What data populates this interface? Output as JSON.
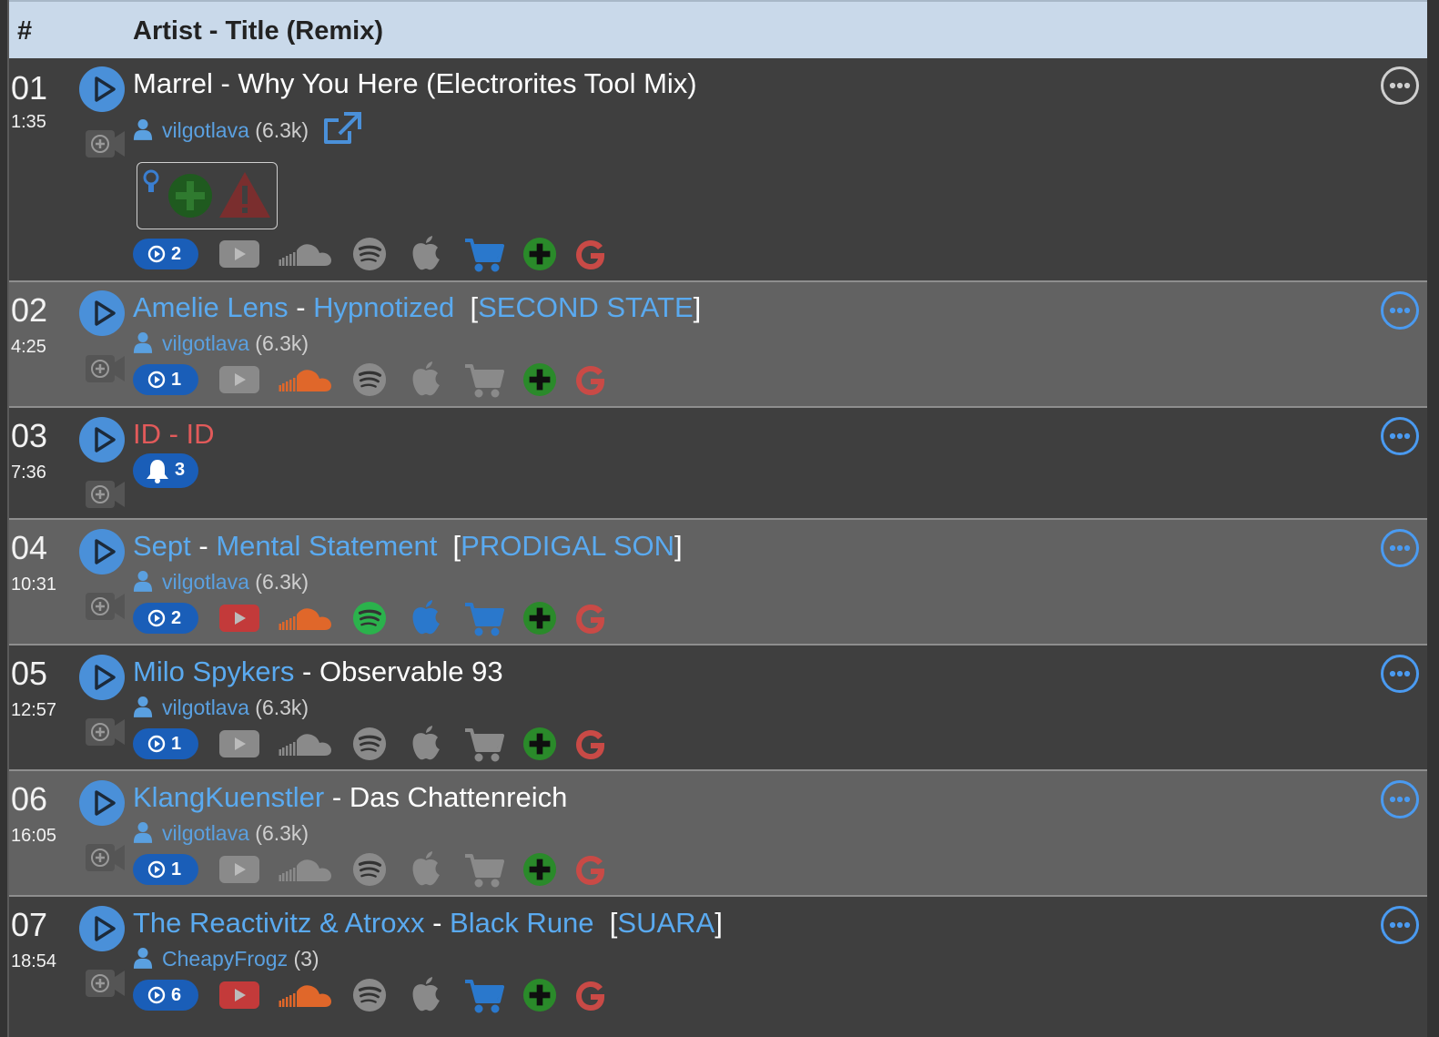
{
  "header": {
    "num": "#",
    "title": "Artist - Title (Remix)"
  },
  "tracks": [
    {
      "num": "01",
      "time": "1:35",
      "title_plain": "Marrel - Why You Here (Electrorites Tool Mix)",
      "user": "vilgotlava",
      "user_count": "(6.3k)",
      "plays": "2"
    },
    {
      "num": "02",
      "time": "4:25",
      "artist": "Amelie Lens",
      "sep": " - ",
      "song": "Hypnotized",
      "label_open": "[",
      "label": "SECOND STATE",
      "label_close": "]",
      "user": "vilgotlava",
      "user_count": "(6.3k)",
      "plays": "1"
    },
    {
      "num": "03",
      "time": "7:36",
      "title_id": "ID - ID",
      "bell": "3"
    },
    {
      "num": "04",
      "time": "10:31",
      "artist": "Sept",
      "sep": " - ",
      "song": "Mental Statement",
      "label_open": "[",
      "label": "PRODIGAL SON",
      "label_close": "]",
      "user": "vilgotlava",
      "user_count": "(6.3k)",
      "plays": "2"
    },
    {
      "num": "05",
      "time": "12:57",
      "artist": "Milo Spykers",
      "sep": " - ",
      "song_plain": "Observable 93",
      "user": "vilgotlava",
      "user_count": "(6.3k)",
      "plays": "1"
    },
    {
      "num": "06",
      "time": "16:05",
      "artist": "KlangKuenstler",
      "sep": " - ",
      "song_plain": "Das Chattenreich",
      "user": "vilgotlava",
      "user_count": "(6.3k)",
      "plays": "1"
    },
    {
      "num": "07",
      "time": "18:54",
      "artist": "The Reactivitz & Atroxx",
      "sep": " - ",
      "song": "Black Rune",
      "label_open": "[",
      "label": "SUARA",
      "label_close": "]",
      "user": "CheapyFrogz",
      "user_count": "(3)",
      "plays": "6"
    }
  ],
  "colors": {
    "accent": "#4a90d9",
    "badge": "#1a5eb8",
    "link": "#5aaaf0",
    "id_red": "#e25a5a",
    "youtube_on": "#c33a3a",
    "soundcloud_on": "#e0672a",
    "spotify_on": "#2bb24c",
    "apple_on": "#2a78cc",
    "cart_on": "#2a78cc",
    "beatport_plus": "#2a8a2a",
    "google_red": "#d9534f",
    "inactive": "#8a8a8a"
  },
  "icon_names": [
    "play-icon",
    "add-video-icon",
    "user-icon",
    "external-link-icon",
    "lightbulb-icon",
    "add-plus-icon",
    "warning-icon",
    "youtube-icon",
    "soundcloud-icon",
    "spotify-icon",
    "apple-icon",
    "cart-icon",
    "beatport-plus-icon",
    "google-icon",
    "more-icon",
    "bell-icon"
  ]
}
